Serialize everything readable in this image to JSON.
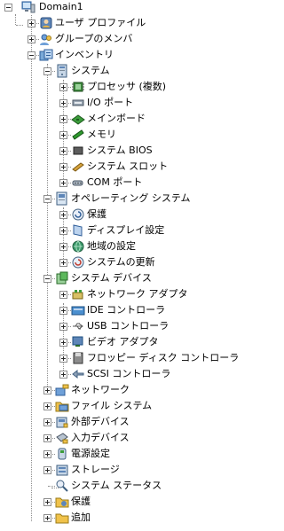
{
  "root": {
    "label": "Domain1",
    "icon": "computer-icon"
  },
  "items": [
    {
      "label": "ユーザ プロファイル",
      "icon": "user-profile-icon",
      "expander": "plus"
    },
    {
      "label": "グループのメンバ",
      "icon": "group-icon",
      "expander": "plus"
    },
    {
      "label": "インベントリ",
      "icon": "inventory-icon",
      "expander": "minus"
    },
    {
      "label": "システム",
      "icon": "system-icon",
      "expander": "minus"
    },
    {
      "label": "プロセッサ (複数)",
      "icon": "processor-icon",
      "expander": "plus"
    },
    {
      "label": "I/O ポート",
      "icon": "io-port-icon",
      "expander": "plus"
    },
    {
      "label": "メインボード",
      "icon": "mainboard-icon",
      "expander": "plus"
    },
    {
      "label": "メモリ",
      "icon": "memory-icon",
      "expander": "plus"
    },
    {
      "label": "システム BIOS",
      "icon": "bios-icon",
      "expander": "plus"
    },
    {
      "label": "システム スロット",
      "icon": "slot-icon",
      "expander": "plus"
    },
    {
      "label": "COM ポート",
      "icon": "com-port-icon",
      "expander": "plus"
    },
    {
      "label": "オペレーティング システム",
      "icon": "os-icon",
      "expander": "minus"
    },
    {
      "label": "保護",
      "icon": "protection-icon",
      "expander": "plus"
    },
    {
      "label": "ディスプレイ設定",
      "icon": "display-icon",
      "expander": "plus"
    },
    {
      "label": "地域の設定",
      "icon": "globe-icon",
      "expander": "plus"
    },
    {
      "label": "システムの更新",
      "icon": "update-icon",
      "expander": "plus"
    },
    {
      "label": "システム デバイス",
      "icon": "system-devices-icon",
      "expander": "minus"
    },
    {
      "label": "ネットワーク アダプタ",
      "icon": "network-adapter-icon",
      "expander": "plus"
    },
    {
      "label": "IDE コントローラ",
      "icon": "ide-controller-icon",
      "expander": "plus"
    },
    {
      "label": "USB コントローラ",
      "icon": "usb-icon",
      "expander": "plus"
    },
    {
      "label": "ビデオ アダプタ",
      "icon": "video-adapter-icon",
      "expander": "plus"
    },
    {
      "label": "フロッピー ディスク コントローラ",
      "icon": "floppy-icon",
      "expander": "plus"
    },
    {
      "label": "SCSI コントローラ",
      "icon": "scsi-icon",
      "expander": "plus"
    },
    {
      "label": "ネットワーク",
      "icon": "network-icon",
      "expander": "plus"
    },
    {
      "label": "ファイル システム",
      "icon": "file-system-icon",
      "expander": "plus"
    },
    {
      "label": "外部デバイス",
      "icon": "external-devices-icon",
      "expander": "plus"
    },
    {
      "label": "入力デバイス",
      "icon": "input-devices-icon",
      "expander": "plus"
    },
    {
      "label": "電源設定",
      "icon": "power-icon",
      "expander": "plus"
    },
    {
      "label": "ストレージ",
      "icon": "storage-icon",
      "expander": "plus"
    },
    {
      "label": "システム ステータス",
      "icon": "system-status-icon",
      "expander": "none"
    },
    {
      "label": "保護",
      "icon": "protection-folder-icon",
      "expander": "plus"
    },
    {
      "label": "追加",
      "icon": "additional-folder-icon",
      "expander": "plus"
    }
  ]
}
